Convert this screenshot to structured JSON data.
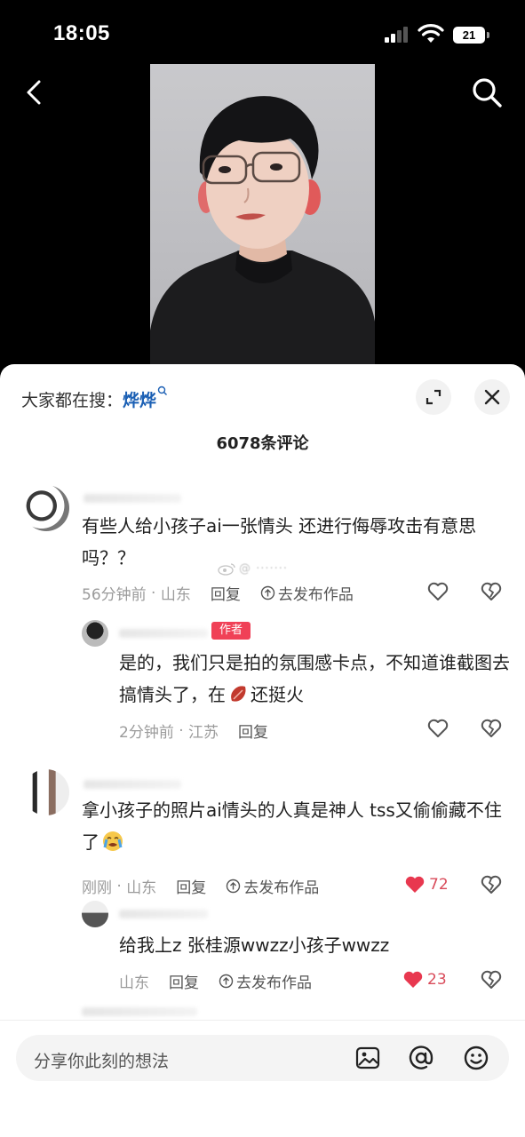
{
  "status_bar": {
    "time": "18:05",
    "battery": "21"
  },
  "sheet": {
    "search_prompt": "大家都在搜：",
    "search_keyword": "烨烨",
    "comment_count": "6078条评论"
  },
  "comments": [
    {
      "text": "有些人给小孩子ai一张情头 还进行侮辱攻击有意思吗？？",
      "time": "56分钟前",
      "location": "山东",
      "reply_label": "回复",
      "publish_label": "去发布作品",
      "likes": ""
    },
    {
      "author_tag": "作者",
      "text": "是的，我们只是拍的氛围感卡点，不知道谁截图去搞情头了，在",
      "text_after_icon": "还挺火",
      "time": "2分钟前",
      "location": "江苏",
      "reply_label": "回复",
      "likes": ""
    },
    {
      "text": "拿小孩子的照片ai情头的人真是神人 tss又偷偷藏不住了",
      "time": "刚刚",
      "location": "山东",
      "reply_label": "回复",
      "publish_label": "去发布作品",
      "likes": "72"
    },
    {
      "text": "给我上z 张桂源wwzz小孩子wwzz",
      "location": "山东",
      "reply_label": "回复",
      "publish_label": "去发布作品",
      "likes": "23"
    }
  ],
  "input": {
    "placeholder": "分享你此刻的想法"
  },
  "icons": {
    "back": "chevron-left-icon",
    "search": "search-icon",
    "expand": "expand-icon",
    "close": "close-icon",
    "like": "heart-icon",
    "dislike": "broken-heart-icon",
    "image": "image-icon",
    "mention": "at-icon",
    "emoji": "emoji-icon"
  },
  "colors": {
    "like_active": "#e8384f",
    "keyword": "#1a5fb4",
    "author_tag": "#f04157"
  }
}
